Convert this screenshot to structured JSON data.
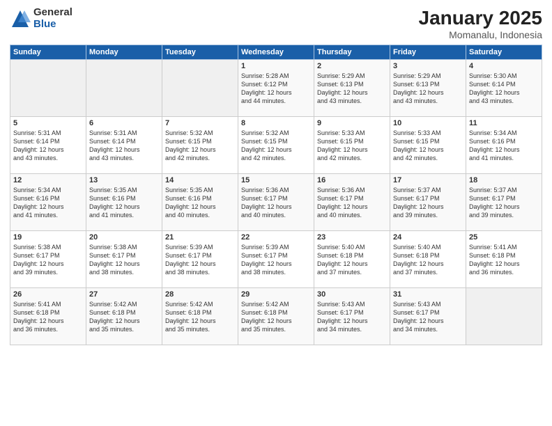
{
  "header": {
    "logo_general": "General",
    "logo_blue": "Blue",
    "month_title": "January 2025",
    "location": "Momanalu, Indonesia"
  },
  "weekdays": [
    "Sunday",
    "Monday",
    "Tuesday",
    "Wednesday",
    "Thursday",
    "Friday",
    "Saturday"
  ],
  "weeks": [
    [
      {
        "day": "",
        "info": ""
      },
      {
        "day": "",
        "info": ""
      },
      {
        "day": "",
        "info": ""
      },
      {
        "day": "1",
        "info": "Sunrise: 5:28 AM\nSunset: 6:12 PM\nDaylight: 12 hours\nand 44 minutes."
      },
      {
        "day": "2",
        "info": "Sunrise: 5:29 AM\nSunset: 6:13 PM\nDaylight: 12 hours\nand 43 minutes."
      },
      {
        "day": "3",
        "info": "Sunrise: 5:29 AM\nSunset: 6:13 PM\nDaylight: 12 hours\nand 43 minutes."
      },
      {
        "day": "4",
        "info": "Sunrise: 5:30 AM\nSunset: 6:14 PM\nDaylight: 12 hours\nand 43 minutes."
      }
    ],
    [
      {
        "day": "5",
        "info": "Sunrise: 5:31 AM\nSunset: 6:14 PM\nDaylight: 12 hours\nand 43 minutes."
      },
      {
        "day": "6",
        "info": "Sunrise: 5:31 AM\nSunset: 6:14 PM\nDaylight: 12 hours\nand 43 minutes."
      },
      {
        "day": "7",
        "info": "Sunrise: 5:32 AM\nSunset: 6:15 PM\nDaylight: 12 hours\nand 42 minutes."
      },
      {
        "day": "8",
        "info": "Sunrise: 5:32 AM\nSunset: 6:15 PM\nDaylight: 12 hours\nand 42 minutes."
      },
      {
        "day": "9",
        "info": "Sunrise: 5:33 AM\nSunset: 6:15 PM\nDaylight: 12 hours\nand 42 minutes."
      },
      {
        "day": "10",
        "info": "Sunrise: 5:33 AM\nSunset: 6:15 PM\nDaylight: 12 hours\nand 42 minutes."
      },
      {
        "day": "11",
        "info": "Sunrise: 5:34 AM\nSunset: 6:16 PM\nDaylight: 12 hours\nand 41 minutes."
      }
    ],
    [
      {
        "day": "12",
        "info": "Sunrise: 5:34 AM\nSunset: 6:16 PM\nDaylight: 12 hours\nand 41 minutes."
      },
      {
        "day": "13",
        "info": "Sunrise: 5:35 AM\nSunset: 6:16 PM\nDaylight: 12 hours\nand 41 minutes."
      },
      {
        "day": "14",
        "info": "Sunrise: 5:35 AM\nSunset: 6:16 PM\nDaylight: 12 hours\nand 40 minutes."
      },
      {
        "day": "15",
        "info": "Sunrise: 5:36 AM\nSunset: 6:17 PM\nDaylight: 12 hours\nand 40 minutes."
      },
      {
        "day": "16",
        "info": "Sunrise: 5:36 AM\nSunset: 6:17 PM\nDaylight: 12 hours\nand 40 minutes."
      },
      {
        "day": "17",
        "info": "Sunrise: 5:37 AM\nSunset: 6:17 PM\nDaylight: 12 hours\nand 39 minutes."
      },
      {
        "day": "18",
        "info": "Sunrise: 5:37 AM\nSunset: 6:17 PM\nDaylight: 12 hours\nand 39 minutes."
      }
    ],
    [
      {
        "day": "19",
        "info": "Sunrise: 5:38 AM\nSunset: 6:17 PM\nDaylight: 12 hours\nand 39 minutes."
      },
      {
        "day": "20",
        "info": "Sunrise: 5:38 AM\nSunset: 6:17 PM\nDaylight: 12 hours\nand 38 minutes."
      },
      {
        "day": "21",
        "info": "Sunrise: 5:39 AM\nSunset: 6:17 PM\nDaylight: 12 hours\nand 38 minutes."
      },
      {
        "day": "22",
        "info": "Sunrise: 5:39 AM\nSunset: 6:17 PM\nDaylight: 12 hours\nand 38 minutes."
      },
      {
        "day": "23",
        "info": "Sunrise: 5:40 AM\nSunset: 6:18 PM\nDaylight: 12 hours\nand 37 minutes."
      },
      {
        "day": "24",
        "info": "Sunrise: 5:40 AM\nSunset: 6:18 PM\nDaylight: 12 hours\nand 37 minutes."
      },
      {
        "day": "25",
        "info": "Sunrise: 5:41 AM\nSunset: 6:18 PM\nDaylight: 12 hours\nand 36 minutes."
      }
    ],
    [
      {
        "day": "26",
        "info": "Sunrise: 5:41 AM\nSunset: 6:18 PM\nDaylight: 12 hours\nand 36 minutes."
      },
      {
        "day": "27",
        "info": "Sunrise: 5:42 AM\nSunset: 6:18 PM\nDaylight: 12 hours\nand 35 minutes."
      },
      {
        "day": "28",
        "info": "Sunrise: 5:42 AM\nSunset: 6:18 PM\nDaylight: 12 hours\nand 35 minutes."
      },
      {
        "day": "29",
        "info": "Sunrise: 5:42 AM\nSunset: 6:18 PM\nDaylight: 12 hours\nand 35 minutes."
      },
      {
        "day": "30",
        "info": "Sunrise: 5:43 AM\nSunset: 6:17 PM\nDaylight: 12 hours\nand 34 minutes."
      },
      {
        "day": "31",
        "info": "Sunrise: 5:43 AM\nSunset: 6:17 PM\nDaylight: 12 hours\nand 34 minutes."
      },
      {
        "day": "",
        "info": ""
      }
    ]
  ]
}
